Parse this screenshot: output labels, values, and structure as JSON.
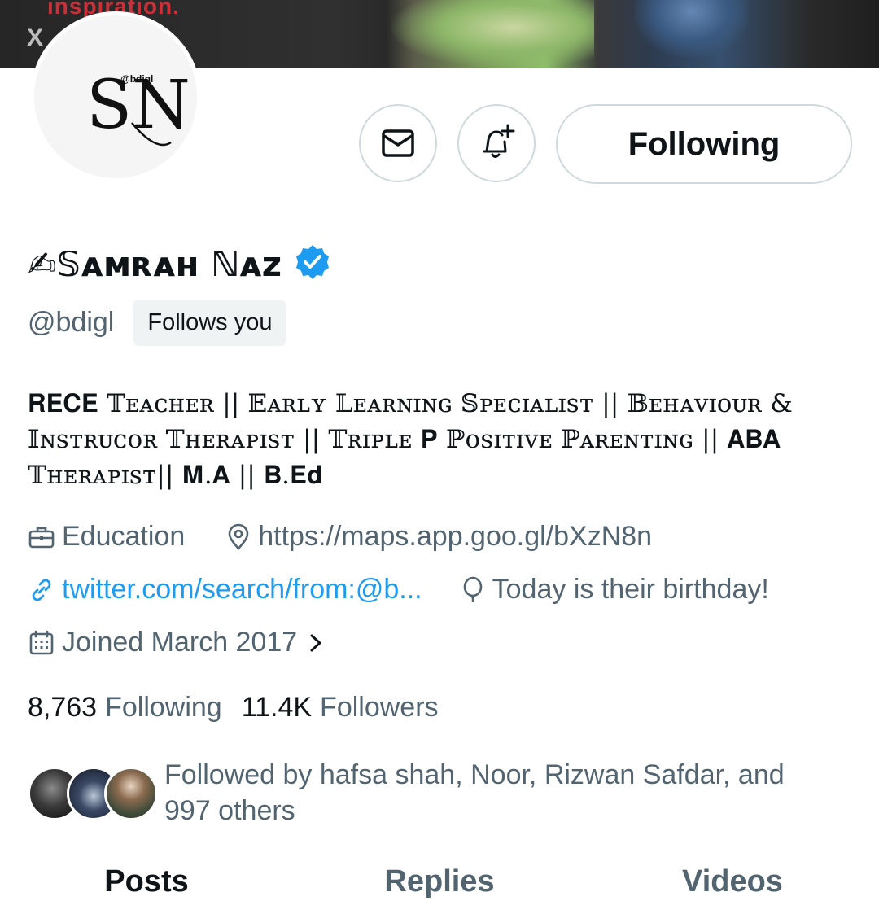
{
  "banner": {
    "text": "inspiration.",
    "close_glyph": "X"
  },
  "avatar": {
    "monogram": "SN",
    "handle_text": "@bdigl"
  },
  "actions": {
    "message_icon": "mail-icon",
    "notify_icon": "bell-plus-icon",
    "following_label": "Following"
  },
  "profile": {
    "name": "✍𝕊ᴀᴍʀᴀʜ ℕᴀᴢ",
    "verified": true,
    "handle": "@bdigl",
    "follows_you": "Follows you",
    "bio": "𝐑𝐄𝐂𝐄 𝕋ᴇᴀᴄʜᴇʀ || 𝔼ᴀʀʟʏ 𝕃ᴇᴀʀɴɪɴɢ 𝕊ᴘᴇᴄɪᴀʟɪsᴛ || 𝔹ᴇʜᴀᴠɪᴏᴜʀ & 𝕀ɴsᴛʀᴜᴄᴏʀ 𝕋ʜᴇʀᴀᴘɪsᴛ || 𝕋ʀɪᴘʟᴇ 𝐏 ℙᴏsɪᴛɪᴠᴇ ℙᴀʀᴇɴᴛɪɴɢ || 𝐀𝐁𝐀 𝕋ʜᴇʀᴀᴘɪsᴛ|| 𝐌.𝐀 || 𝐁.𝐄𝐝"
  },
  "meta": {
    "category": "Education",
    "location": "https://maps.app.goo.gl/bXzN8n",
    "website": "twitter.com/search/from:@b...",
    "birthday": "Today is their birthday!",
    "joined": "Joined March 2017"
  },
  "counts": {
    "following_num": "8,763",
    "following_label": "Following",
    "followers_num": "11.4K",
    "followers_label": "Followers"
  },
  "followed_by": {
    "text": "Followed by hafsa shah, Noor, Rizwan Safdar, and 997 others"
  },
  "tabs": [
    {
      "label": "Posts",
      "active": true
    },
    {
      "label": "Replies",
      "active": false
    },
    {
      "label": "Videos",
      "active": false
    }
  ],
  "colors": {
    "link": "#1d9bf0",
    "secondary_text": "#536471",
    "primary_text": "#0f1419",
    "verified_badge": "#1d9bf0"
  }
}
